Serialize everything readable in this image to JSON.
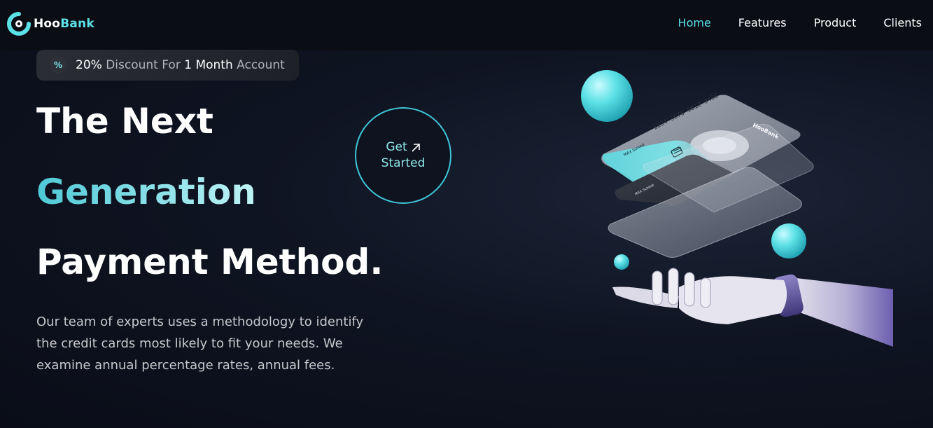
{
  "brand": {
    "name_part1": "Hoo",
    "name_part2": "Bank",
    "card_brand": "HooBank"
  },
  "nav": {
    "items": [
      {
        "label": "Home",
        "active": true
      },
      {
        "label": "Features",
        "active": false
      },
      {
        "label": "Product",
        "active": false
      },
      {
        "label": "Clients",
        "active": false
      }
    ]
  },
  "promo": {
    "icon": "discount-icon",
    "percent": "20%",
    "text1": "Discount",
    "text2": "For",
    "highlight": "1 Month",
    "text3": "Account"
  },
  "hero": {
    "line1": "The Next",
    "line2": "Generation",
    "line3": "Payment Method.",
    "description": "Our team of experts uses a methodology to identify the credit cards most likely to fit your needs. We examine annual percentage rates, annual fees."
  },
  "cta": {
    "line1": "Get",
    "line2": "Started",
    "icon": "arrow-up-right-icon"
  },
  "card": {
    "number": "1234 5678 9012 3456",
    "holder": "MAX SUHAR",
    "holder_sub": "Private"
  },
  "colors": {
    "accent": "#5ce1e6",
    "background": "#0f1422",
    "text_muted": "#c7c8cc"
  }
}
